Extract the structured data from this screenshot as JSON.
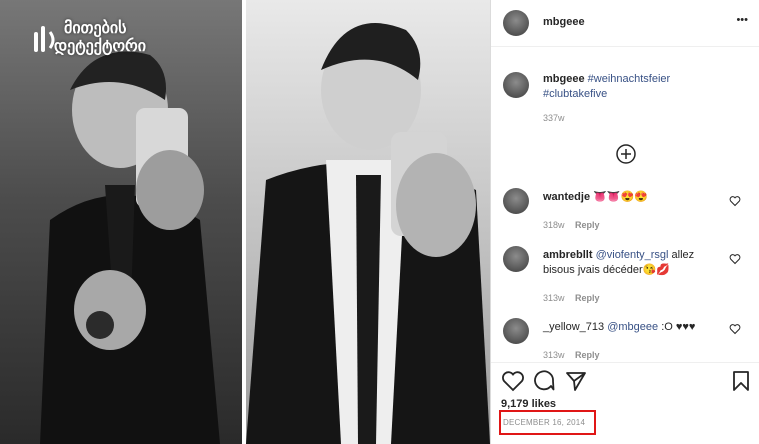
{
  "watermark": {
    "line1": "მითების",
    "line2": "დეტექტორი"
  },
  "post": {
    "username": "mbgeee",
    "more_label": "•••",
    "caption_user": "mbgeee",
    "caption_tags": [
      "#weihnachtsfeier",
      "#clubtakefive"
    ],
    "caption_age": "337w"
  },
  "comments": [
    {
      "user": "wantedje",
      "text": "👅👅😍😍",
      "age": "318w",
      "reply": "Reply"
    },
    {
      "user": "ambrebllt",
      "mention": "@viofenty_rsgl",
      "text_line1": " allez",
      "text_line2": "bisous jvais décéder😘💋",
      "age": "313w",
      "reply": "Reply"
    },
    {
      "user": "_yellow_713",
      "mention": "@mbgeee",
      "text": " :O ♥♥♥",
      "age": "313w",
      "reply": "Reply"
    }
  ],
  "likes": "9,179 likes",
  "date": "DECEMBER 16, 2014",
  "icons": {
    "more": "more-icon",
    "load_more": "plus-circle-icon",
    "like": "heart-icon",
    "comment": "comment-icon",
    "share": "share-icon",
    "save": "bookmark-icon"
  },
  "colors": {
    "highlight": "#e01616",
    "link": "#385185"
  }
}
